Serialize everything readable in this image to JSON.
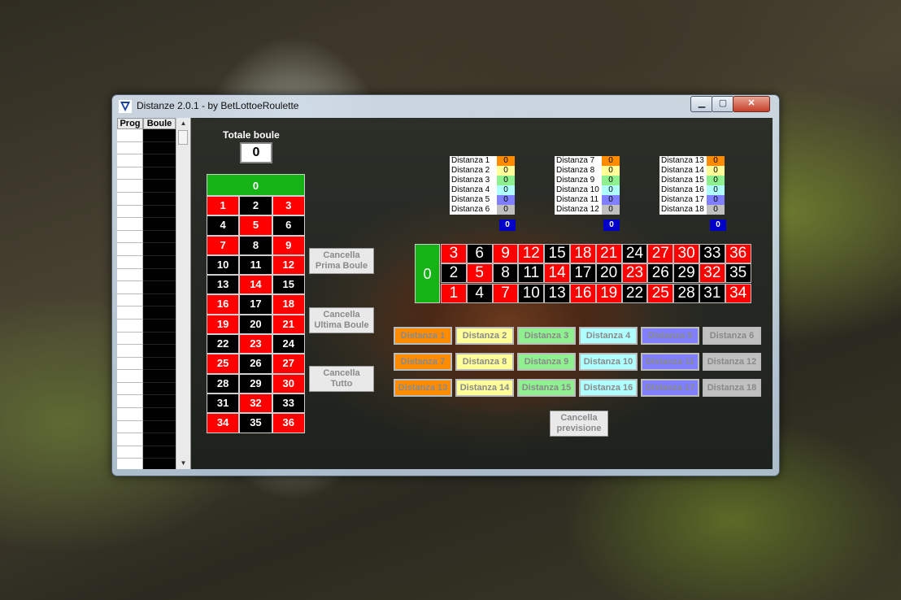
{
  "window": {
    "title": "Distanze 2.0.1 - by BetLottoeRoulette",
    "min_glyph": "▁",
    "max_glyph": "▢",
    "close_glyph": "✕"
  },
  "progress_list": {
    "header_prog": "Prog",
    "header_boule": "Boule",
    "row_count": 27,
    "scroll_up": "▲",
    "scroll_down": "▼"
  },
  "totale": {
    "label": "Totale boule",
    "value": "0"
  },
  "colors": {
    "red": "#ff0000",
    "black": "#000000",
    "green": "#15b315",
    "blue": "#0000c8"
  },
  "left_grid": {
    "zero": "0",
    "rows": [
      [
        {
          "n": "1",
          "c": "red"
        },
        {
          "n": "2",
          "c": "black"
        },
        {
          "n": "3",
          "c": "red"
        }
      ],
      [
        {
          "n": "4",
          "c": "black"
        },
        {
          "n": "5",
          "c": "red"
        },
        {
          "n": "6",
          "c": "black"
        }
      ],
      [
        {
          "n": "7",
          "c": "red"
        },
        {
          "n": "8",
          "c": "black"
        },
        {
          "n": "9",
          "c": "red"
        }
      ],
      [
        {
          "n": "10",
          "c": "black"
        },
        {
          "n": "11",
          "c": "black"
        },
        {
          "n": "12",
          "c": "red"
        }
      ],
      [
        {
          "n": "13",
          "c": "black"
        },
        {
          "n": "14",
          "c": "red"
        },
        {
          "n": "15",
          "c": "black"
        }
      ],
      [
        {
          "n": "16",
          "c": "red"
        },
        {
          "n": "17",
          "c": "black"
        },
        {
          "n": "18",
          "c": "red"
        }
      ],
      [
        {
          "n": "19",
          "c": "red"
        },
        {
          "n": "20",
          "c": "black"
        },
        {
          "n": "21",
          "c": "red"
        }
      ],
      [
        {
          "n": "22",
          "c": "black"
        },
        {
          "n": "23",
          "c": "red"
        },
        {
          "n": "24",
          "c": "black"
        }
      ],
      [
        {
          "n": "25",
          "c": "red"
        },
        {
          "n": "26",
          "c": "black"
        },
        {
          "n": "27",
          "c": "red"
        }
      ],
      [
        {
          "n": "28",
          "c": "black"
        },
        {
          "n": "29",
          "c": "black"
        },
        {
          "n": "30",
          "c": "red"
        }
      ],
      [
        {
          "n": "31",
          "c": "black"
        },
        {
          "n": "32",
          "c": "red"
        },
        {
          "n": "33",
          "c": "black"
        }
      ],
      [
        {
          "n": "34",
          "c": "red"
        },
        {
          "n": "35",
          "c": "black"
        },
        {
          "n": "36",
          "c": "red"
        }
      ]
    ]
  },
  "buttons": {
    "cancella_prima": [
      "Cancella",
      "Prima Boule"
    ],
    "cancella_ultima": [
      "Cancella",
      "Ultima Boule"
    ],
    "cancella_tutto": [
      "Cancella",
      "Tutto"
    ],
    "cancella_previsione": [
      "Cancella",
      "previsione"
    ]
  },
  "dist_colors": [
    "#ff8c00",
    "#ffff99",
    "#8ff08f",
    "#b0ffff",
    "#7f7fff",
    "#c0c0c0"
  ],
  "distance_tables": [
    {
      "rows": [
        [
          "Distanza 1",
          "0"
        ],
        [
          "Distanza 2",
          "0"
        ],
        [
          "Distanza 3",
          "0"
        ],
        [
          "Distanza 4",
          "0"
        ],
        [
          "Distanza 5",
          "0"
        ],
        [
          "Distanza 6",
          "0"
        ]
      ],
      "total": "0"
    },
    {
      "rows": [
        [
          "Distanza 7",
          "0"
        ],
        [
          "Distanza 8",
          "0"
        ],
        [
          "Distanza 9",
          "0"
        ],
        [
          "Distanza 10",
          "0"
        ],
        [
          "Distanza 11",
          "0"
        ],
        [
          "Distanza 12",
          "0"
        ]
      ],
      "total": "0"
    },
    {
      "rows": [
        [
          "Distanza 13",
          "0"
        ],
        [
          "Distanza 14",
          "0"
        ],
        [
          "Distanza 15",
          "0"
        ],
        [
          "Distanza 16",
          "0"
        ],
        [
          "Distanza 17",
          "0"
        ],
        [
          "Distanza 18",
          "0"
        ]
      ],
      "total": "0"
    }
  ],
  "big_grid": {
    "zero": "0",
    "rows": [
      [
        {
          "n": "3",
          "c": "red"
        },
        {
          "n": "6",
          "c": "black"
        },
        {
          "n": "9",
          "c": "red"
        },
        {
          "n": "12",
          "c": "red"
        },
        {
          "n": "15",
          "c": "black"
        },
        {
          "n": "18",
          "c": "red"
        },
        {
          "n": "21",
          "c": "red"
        },
        {
          "n": "24",
          "c": "black"
        },
        {
          "n": "27",
          "c": "red"
        },
        {
          "n": "30",
          "c": "red"
        },
        {
          "n": "33",
          "c": "black"
        },
        {
          "n": "36",
          "c": "red"
        }
      ],
      [
        {
          "n": "2",
          "c": "black"
        },
        {
          "n": "5",
          "c": "red"
        },
        {
          "n": "8",
          "c": "black"
        },
        {
          "n": "11",
          "c": "black"
        },
        {
          "n": "14",
          "c": "red"
        },
        {
          "n": "17",
          "c": "black"
        },
        {
          "n": "20",
          "c": "black"
        },
        {
          "n": "23",
          "c": "red"
        },
        {
          "n": "26",
          "c": "black"
        },
        {
          "n": "29",
          "c": "black"
        },
        {
          "n": "32",
          "c": "red"
        },
        {
          "n": "35",
          "c": "black"
        }
      ],
      [
        {
          "n": "1",
          "c": "red"
        },
        {
          "n": "4",
          "c": "black"
        },
        {
          "n": "7",
          "c": "red"
        },
        {
          "n": "10",
          "c": "black"
        },
        {
          "n": "13",
          "c": "black"
        },
        {
          "n": "16",
          "c": "red"
        },
        {
          "n": "19",
          "c": "red"
        },
        {
          "n": "22",
          "c": "black"
        },
        {
          "n": "25",
          "c": "red"
        },
        {
          "n": "28",
          "c": "black"
        },
        {
          "n": "31",
          "c": "black"
        },
        {
          "n": "34",
          "c": "red"
        }
      ]
    ]
  },
  "distance_buttons": [
    [
      "Distanza 1",
      "Distanza 2",
      "Distanza 3",
      "Distanza 4",
      "Distanza 5",
      "Distanza 6"
    ],
    [
      "Distanza 7",
      "Distanza 8",
      "Distanza 9",
      "Distanza 10",
      "Distanza 11",
      "Distanza 12"
    ],
    [
      "Distanza 13",
      "Distanza 14",
      "Distanza 15",
      "Distanza 16",
      "Distanza 17",
      "Distanza 18"
    ]
  ]
}
